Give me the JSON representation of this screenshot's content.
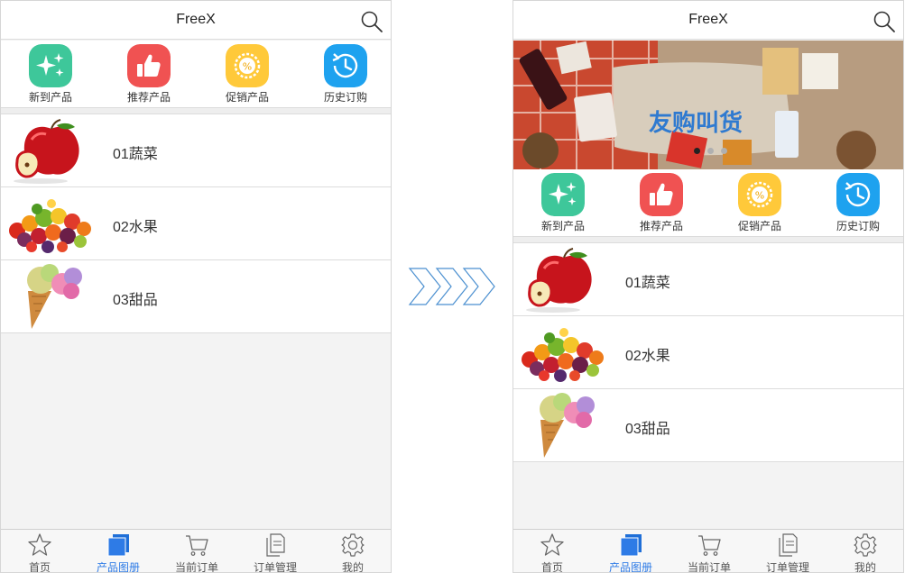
{
  "left_screen": {
    "title": "FreeX",
    "quick_actions": [
      {
        "label": "新到产品",
        "icon": "sparkle-icon",
        "color": "#3ec79a"
      },
      {
        "label": "推荐产品",
        "icon": "thumbs-up-icon",
        "color": "#f05252"
      },
      {
        "label": "促销产品",
        "icon": "discount-badge-icon",
        "color": "#ffc93a"
      },
      {
        "label": "历史订购",
        "icon": "history-clock-icon",
        "color": "#1ea2ef"
      }
    ],
    "categories": [
      {
        "name": "01蔬菜",
        "image": "apple-image"
      },
      {
        "name": "02水果",
        "image": "fruits-image"
      },
      {
        "name": "03甜品",
        "image": "ice-cream-image"
      }
    ],
    "tabs": [
      {
        "label": "首页",
        "icon": "star-icon",
        "active": false
      },
      {
        "label": "产品图册",
        "icon": "album-icon",
        "active": true
      },
      {
        "label": "当前订单",
        "icon": "cart-icon",
        "active": false
      },
      {
        "label": "订单管理",
        "icon": "document-icon",
        "active": false
      },
      {
        "label": "我的",
        "icon": "gear-icon",
        "active": false
      }
    ]
  },
  "right_screen": {
    "title": "FreeX",
    "banner": {
      "text": "友购叫货",
      "slides": 3,
      "active_slide": 1
    },
    "quick_actions": [
      {
        "label": "新到产品",
        "icon": "sparkle-icon",
        "color": "#3ec79a"
      },
      {
        "label": "推荐产品",
        "icon": "thumbs-up-icon",
        "color": "#f05252"
      },
      {
        "label": "促销产品",
        "icon": "discount-badge-icon",
        "color": "#ffc93a"
      },
      {
        "label": "历史订购",
        "icon": "history-clock-icon",
        "color": "#1ea2ef"
      }
    ],
    "categories": [
      {
        "name": "01蔬菜",
        "image": "apple-image"
      },
      {
        "name": "02水果",
        "image": "fruits-image"
      },
      {
        "name": "03甜品",
        "image": "ice-cream-image"
      }
    ],
    "tabs": [
      {
        "label": "首页",
        "icon": "star-icon",
        "active": false
      },
      {
        "label": "产品图册",
        "icon": "album-icon",
        "active": true
      },
      {
        "label": "当前订单",
        "icon": "cart-icon",
        "active": false
      },
      {
        "label": "订单管理",
        "icon": "document-icon",
        "active": false
      },
      {
        "label": "我的",
        "icon": "gear-icon",
        "active": false
      }
    ]
  },
  "colors": {
    "accent": "#2e7be6",
    "arrow": "#4a8fd0"
  }
}
